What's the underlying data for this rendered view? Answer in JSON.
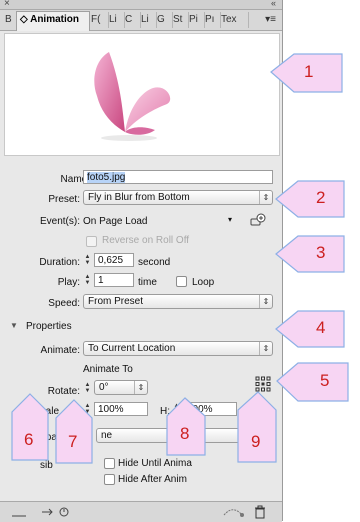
{
  "panel": {
    "tabs": [
      {
        "label": "B"
      },
      {
        "label": "◇ Animation"
      },
      {
        "label": "F("
      },
      {
        "label": "Li"
      },
      {
        "label": "C"
      },
      {
        "label": "Li"
      },
      {
        "label": "G"
      },
      {
        "label": "St"
      },
      {
        "label": "Pi"
      },
      {
        "label": "Pı"
      },
      {
        "label": "Tex"
      }
    ],
    "tab_menu_icon": "▾≡",
    "close_icon": "×",
    "collapse_icon": "«"
  },
  "form": {
    "name_label": "Name:",
    "name_value": "foto5.jpg",
    "preset_label": "Preset:",
    "preset_value": "Fly in Blur from Bottom",
    "events_label": "Event(s):",
    "events_value": "On Page Load",
    "reverse_label": "Reverse on Roll Off",
    "duration_label": "Duration:",
    "duration_value": "0,625",
    "duration_unit": "second",
    "play_label": "Play:",
    "play_value": "1",
    "play_unit": "time",
    "loop_label": "Loop",
    "speed_label": "Speed:",
    "speed_value": "From Preset"
  },
  "properties": {
    "header": "Properties",
    "animate_label": "Animate:",
    "animate_value": "To Current Location",
    "animate_to_label": "Animate To",
    "rotate_label": "Rotate:",
    "rotate_value": "0°",
    "scale_label": "Scale",
    "w_label": "W:",
    "w_value": "100%",
    "h_label": "H:",
    "h_value": "100%",
    "opacity_label": "Opa",
    "opacity_value": "ne",
    "visibility_label": "sib",
    "hide_until": "Hide Until Anima",
    "hide_after": "Hide After Anim"
  },
  "callouts": [
    "1",
    "2",
    "3",
    "4",
    "5",
    "6",
    "7",
    "8",
    "9"
  ],
  "colors": {
    "callout_fill": "#f7d5f3",
    "callout_stroke": "#8db0e6",
    "callout_text": "#cc1f1f",
    "butterfly": "#e07fb0"
  }
}
